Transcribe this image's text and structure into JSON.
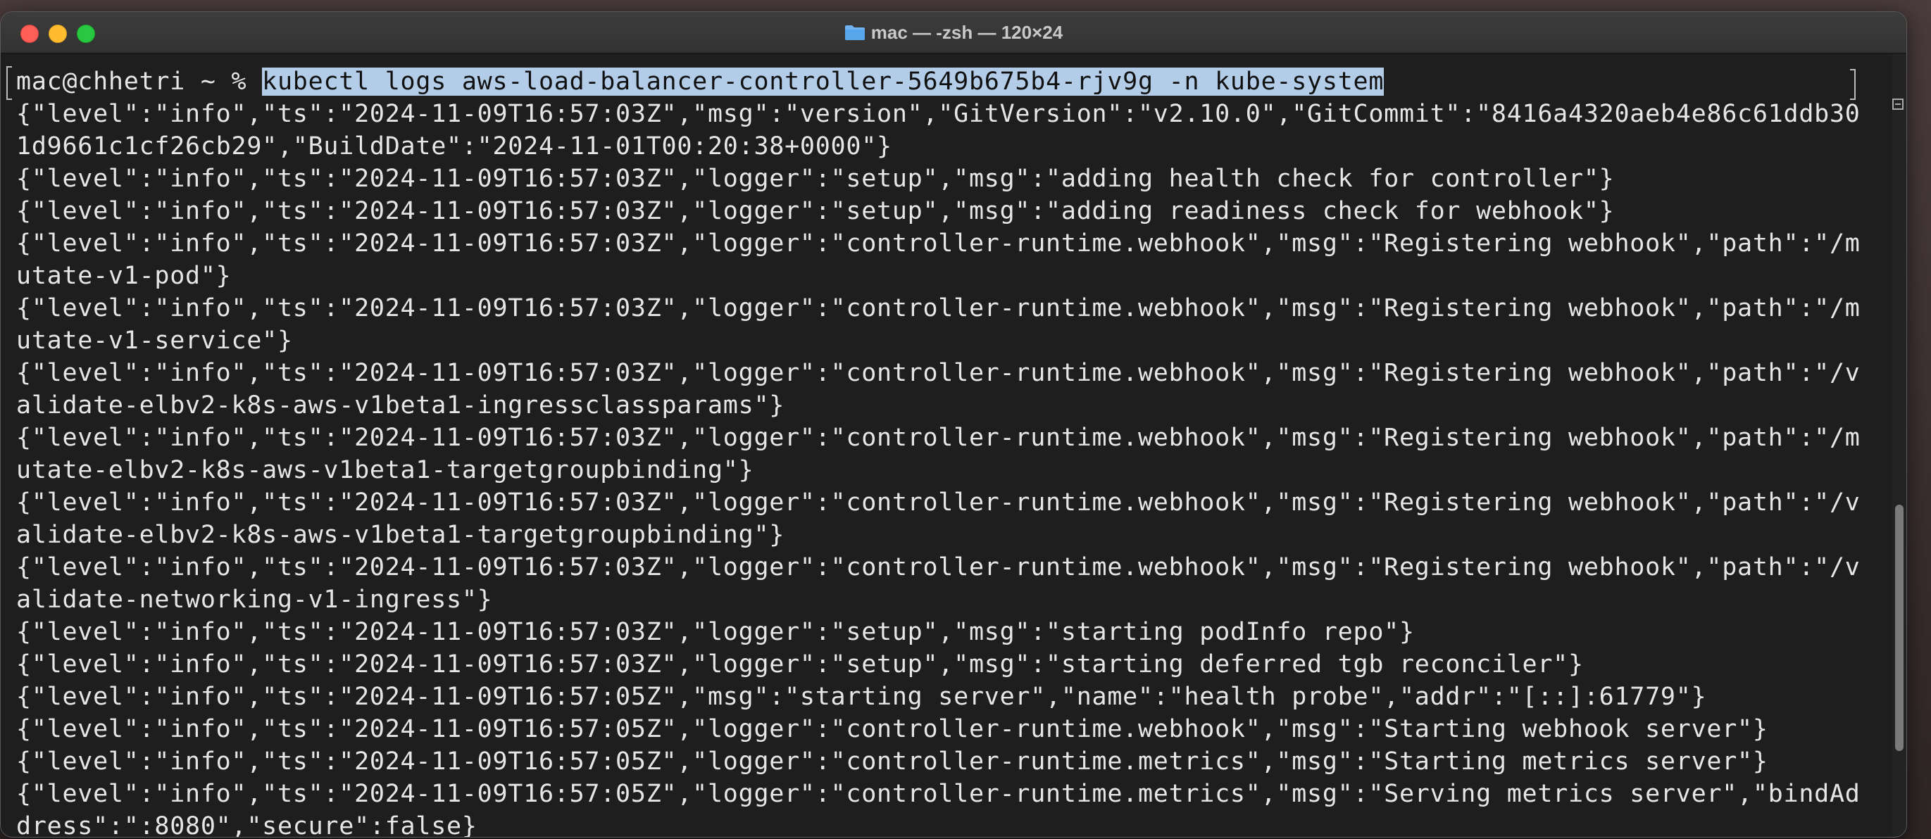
{
  "window": {
    "title": "mac — -zsh — 120×24",
    "folder_icon": "folder-icon"
  },
  "terminal": {
    "prompt": "mac@chhetri ~ % ",
    "command": "kubectl logs aws-load-balancer-controller-5649b675b4-rjv9g -n kube-system",
    "command_highlight_color": "#b3cde8",
    "output_lines": [
      "{\"level\":\"info\",\"ts\":\"2024-11-09T16:57:03Z\",\"msg\":\"version\",\"GitVersion\":\"v2.10.0\",\"GitCommit\":\"8416a4320aeb4e86c61ddb30",
      "1d9661c1cf26cb29\",\"BuildDate\":\"2024-11-01T00:20:38+0000\"}",
      "{\"level\":\"info\",\"ts\":\"2024-11-09T16:57:03Z\",\"logger\":\"setup\",\"msg\":\"adding health check for controller\"}",
      "{\"level\":\"info\",\"ts\":\"2024-11-09T16:57:03Z\",\"logger\":\"setup\",\"msg\":\"adding readiness check for webhook\"}",
      "{\"level\":\"info\",\"ts\":\"2024-11-09T16:57:03Z\",\"logger\":\"controller-runtime.webhook\",\"msg\":\"Registering webhook\",\"path\":\"/m",
      "utate-v1-pod\"}",
      "{\"level\":\"info\",\"ts\":\"2024-11-09T16:57:03Z\",\"logger\":\"controller-runtime.webhook\",\"msg\":\"Registering webhook\",\"path\":\"/m",
      "utate-v1-service\"}",
      "{\"level\":\"info\",\"ts\":\"2024-11-09T16:57:03Z\",\"logger\":\"controller-runtime.webhook\",\"msg\":\"Registering webhook\",\"path\":\"/v",
      "alidate-elbv2-k8s-aws-v1beta1-ingressclassparams\"}",
      "{\"level\":\"info\",\"ts\":\"2024-11-09T16:57:03Z\",\"logger\":\"controller-runtime.webhook\",\"msg\":\"Registering webhook\",\"path\":\"/m",
      "utate-elbv2-k8s-aws-v1beta1-targetgroupbinding\"}",
      "{\"level\":\"info\",\"ts\":\"2024-11-09T16:57:03Z\",\"logger\":\"controller-runtime.webhook\",\"msg\":\"Registering webhook\",\"path\":\"/v",
      "alidate-elbv2-k8s-aws-v1beta1-targetgroupbinding\"}",
      "{\"level\":\"info\",\"ts\":\"2024-11-09T16:57:03Z\",\"logger\":\"controller-runtime.webhook\",\"msg\":\"Registering webhook\",\"path\":\"/v",
      "alidate-networking-v1-ingress\"}",
      "{\"level\":\"info\",\"ts\":\"2024-11-09T16:57:03Z\",\"logger\":\"setup\",\"msg\":\"starting podInfo repo\"}",
      "{\"level\":\"info\",\"ts\":\"2024-11-09T16:57:03Z\",\"logger\":\"setup\",\"msg\":\"starting deferred tgb reconciler\"}",
      "{\"level\":\"info\",\"ts\":\"2024-11-09T16:57:05Z\",\"msg\":\"starting server\",\"name\":\"health probe\",\"addr\":\"[::]:61779\"}",
      "{\"level\":\"info\",\"ts\":\"2024-11-09T16:57:05Z\",\"logger\":\"controller-runtime.webhook\",\"msg\":\"Starting webhook server\"}",
      "{\"level\":\"info\",\"ts\":\"2024-11-09T16:57:05Z\",\"logger\":\"controller-runtime.metrics\",\"msg\":\"Starting metrics server\"}",
      "{\"level\":\"info\",\"ts\":\"2024-11-09T16:57:05Z\",\"logger\":\"controller-runtime.metrics\",\"msg\":\"Serving metrics server\",\"bindAd",
      "dress\":\":8080\",\"secure\":false}"
    ]
  },
  "colors": {
    "close": "#ff5f57",
    "minimize": "#febc2e",
    "maximize": "#28c840",
    "background": "#1e1e1e",
    "text": "#e6e6e6"
  }
}
